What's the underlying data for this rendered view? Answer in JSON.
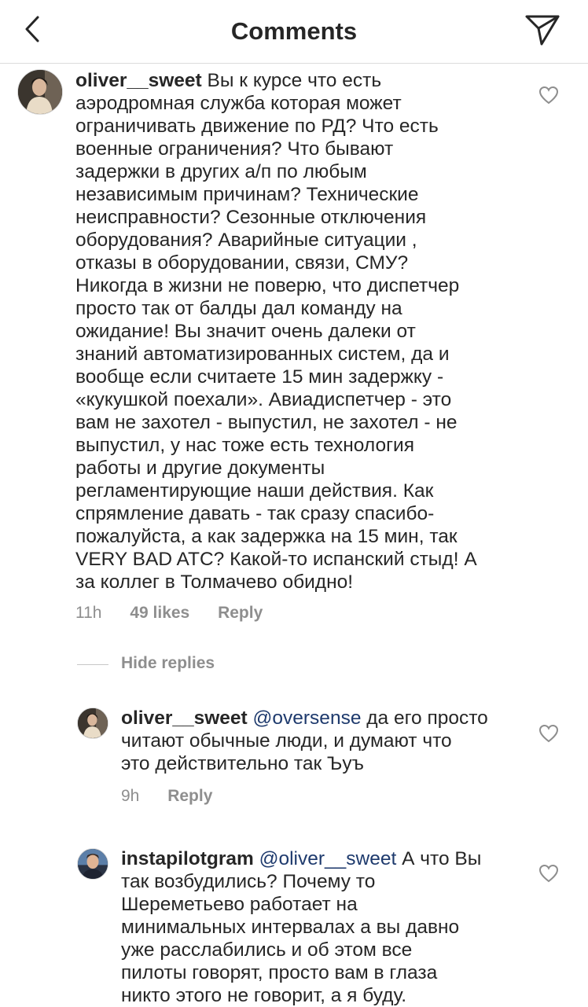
{
  "header": {
    "title": "Comments",
    "back_icon": "chevron-left-icon",
    "send_icon": "paper-plane-icon"
  },
  "comments": [
    {
      "username": "oliver__sweet",
      "lines": [
        "Вы к курсе что есть",
        "аэродромная служба которая может",
        "ограничивать движение по РД? Что есть",
        "военные ограничения? Что бывают",
        "задержки в других а/п по любым",
        "независимым причинам? Технические",
        "неисправности? Сезонные отключения",
        "оборудования? Аварийные ситуации ,",
        "отказы в оборудовании, связи, СМУ?",
        "Никогда в жизни не поверю, что диспетчер",
        "просто так от балды дал команду на",
        "ожидание! Вы значит очень далеки от",
        "знаний автоматизированных систем, да и",
        "вообще если считаете 15 мин задержку -",
        "«кукушкой поехали». Авиадиспетчер - это",
        "вам не захотел - выпустил, не захотел - не",
        "выпустил, у нас тоже есть технология",
        "работы и другие документы",
        "регламентирующие наши действия. Как",
        "спрямление давать - так сразу спасибо-",
        "пожалуйста, а как задержка на 15 мин, так",
        "VERY BAD ATC? Какой-то испанский стыд! А",
        "за коллег в Толмачево обидно!"
      ],
      "time": "11h",
      "likes": "49 likes",
      "reply": "Reply"
    },
    {
      "username": "oliver__sweet",
      "mention": "@oversense",
      "lines": [
        "да его просто",
        "читают обычные люди, и думают что",
        "это действительно так Ъуъ"
      ],
      "time": "9h",
      "reply": "Reply"
    },
    {
      "username": "instapilotgram",
      "mention": "@oliver__sweet",
      "lines": [
        "А что Вы",
        "так возбудились? Почему то",
        "Шереметьево  работает на",
        "минимальных интервалах а вы давно",
        "уже расслабились и об этом все",
        "пилоты говорят, просто вам в глаза",
        "никто этого не говорит, а я буду."
      ]
    }
  ],
  "hide_replies": "Hide replies",
  "icons": {
    "like": "heart-icon"
  },
  "colors": {
    "text": "#262626",
    "muted": "#8e8e8e",
    "mention": "#1e3a6d",
    "divider": "#dbdbdb"
  }
}
